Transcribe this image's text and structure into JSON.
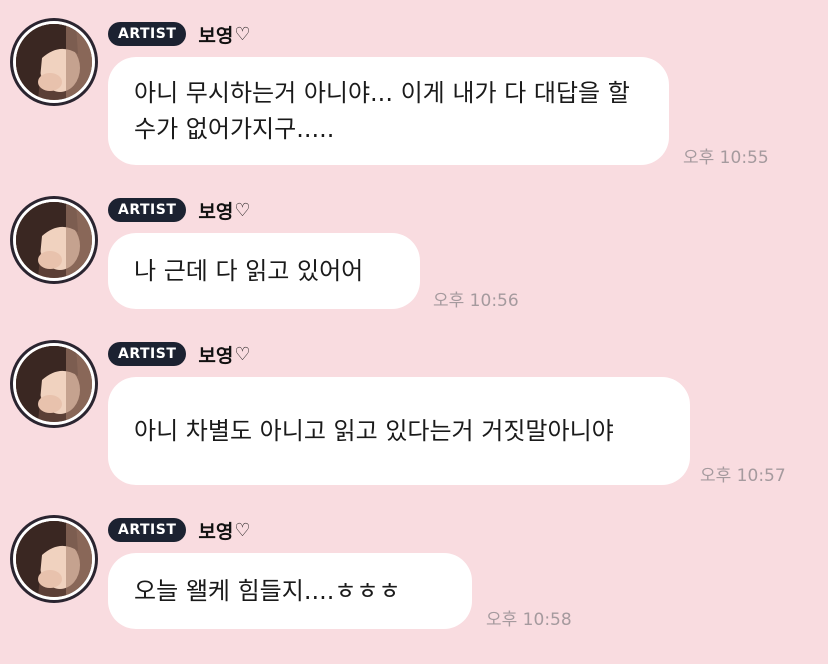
{
  "messages": [
    {
      "badge": "ARTIST",
      "sender": "보영",
      "heart": "♡",
      "text": "아니 무시하는거 아니야... 이게 내가 다 대답을 할 수가 없어가지구.....",
      "time": "오후 10:55"
    },
    {
      "badge": "ARTIST",
      "sender": "보영",
      "heart": "♡",
      "text": "나 근데 다 읽고 있어어",
      "time": "오후 10:56"
    },
    {
      "badge": "ARTIST",
      "sender": "보영",
      "heart": "♡",
      "text": "아니 차별도 아니고 읽고 있다는거 거짓말아니야",
      "time": "오후 10:57"
    },
    {
      "badge": "ARTIST",
      "sender": "보영",
      "heart": "♡",
      "text": "오늘 왤케 힘들지....ㅎㅎㅎ",
      "time": "오후 10:58"
    }
  ],
  "colors": {
    "background": "#F9DCE0",
    "bubble": "#FFFFFF",
    "badge": "#1C2231",
    "time": "#A59A9E"
  }
}
